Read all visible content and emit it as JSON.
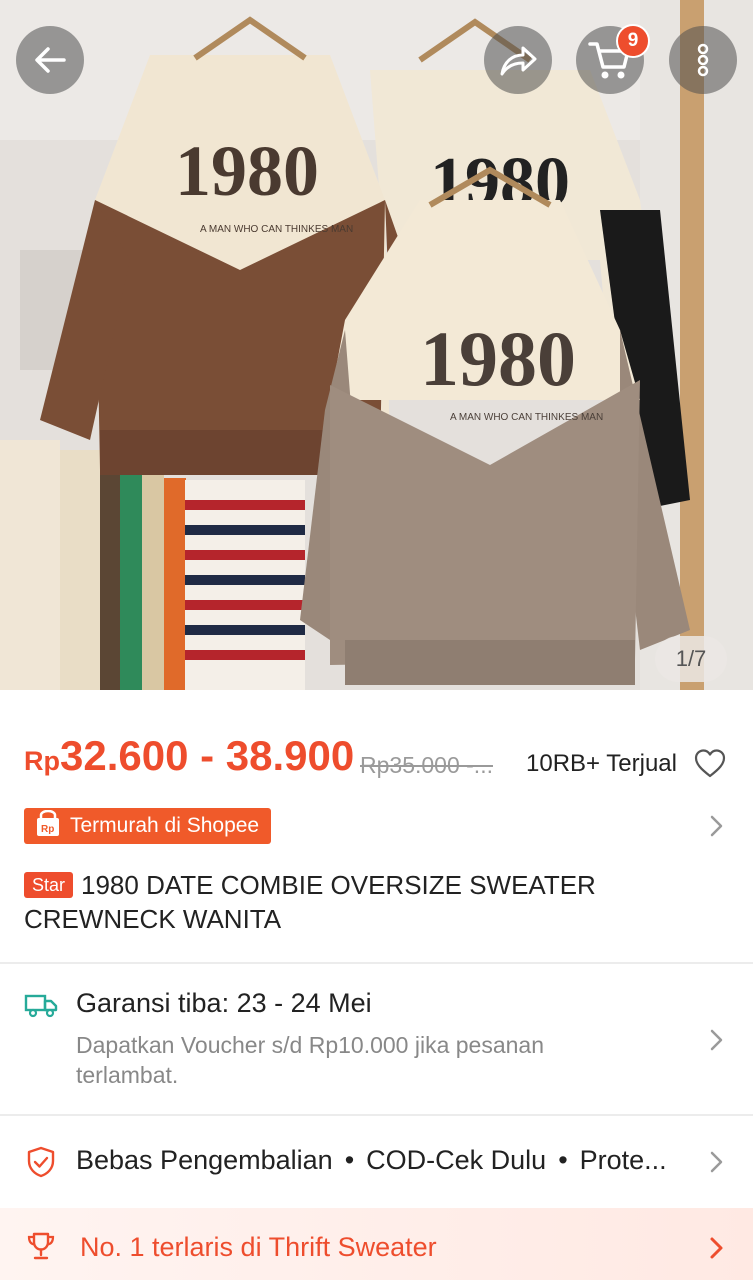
{
  "gallery": {
    "page_indicator": "1/7",
    "cart_count": "9"
  },
  "price": {
    "currency": "Rp",
    "range": "32.600 - 38.900",
    "original": "Rp35.000 -...",
    "sold": "10RB+ Terjual"
  },
  "promo": {
    "label": "Termurah di Shopee"
  },
  "product": {
    "badge": "Star",
    "title": "1980 DATE COMBIE OVERSIZE SWEATER CREWNECK WANITA"
  },
  "shipping": {
    "title": "Garansi tiba: 23 - 24 Mei",
    "subtitle": "Dapatkan Voucher s/d Rp10.000 jika pesanan terlambat."
  },
  "guarantees": {
    "items": [
      "Bebas Pengembalian",
      "COD-Cek Dulu",
      "Prote..."
    ],
    "separator": "•"
  },
  "best_seller": {
    "label": "No. 1 terlaris di Thrift Sweater"
  },
  "colors": {
    "accent": "#ee4d2d",
    "shipping_icon": "#26aa99"
  }
}
